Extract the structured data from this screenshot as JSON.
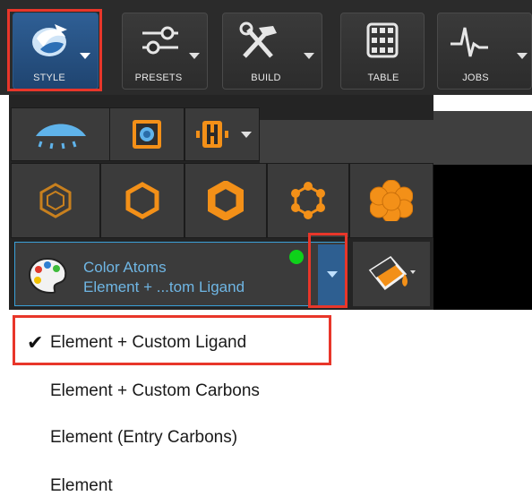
{
  "toolbar": {
    "buttons": [
      {
        "label": "STYLE",
        "icon": "style-palette-icon",
        "selected": true,
        "has_dropdown": true
      },
      {
        "label": "PRESETS",
        "icon": "sliders-icon",
        "selected": false,
        "has_dropdown": true
      },
      {
        "label": "BUILD",
        "icon": "hammer-wrench-icon",
        "selected": false,
        "has_dropdown": true
      },
      {
        "label": "TABLE",
        "icon": "table-grid-icon",
        "selected": false,
        "has_dropdown": false
      },
      {
        "label": "JOBS",
        "icon": "pulse-icon",
        "selected": false,
        "has_dropdown": true
      }
    ]
  },
  "style_panel": {
    "row1_icons": [
      "eye-icon",
      "surface-icon",
      "hbond-icon"
    ],
    "row2_icons": [
      "wire-hexagon-icon",
      "thin-hexagon-icon",
      "thick-hexagon-icon",
      "ball-stick-icon",
      "spacefill-icon"
    ],
    "color_scheme": {
      "title": "Color Atoms",
      "value": "Element + ...tom Ligand",
      "status_color": "#0ed11a"
    }
  },
  "color_menu": {
    "items": [
      {
        "label": "Element + Custom Ligand",
        "checked": true
      },
      {
        "label": "Element + Custom Carbons",
        "checked": false
      },
      {
        "label": "Element (Entry Carbons)",
        "checked": false
      },
      {
        "label": "Element",
        "checked": false
      }
    ]
  },
  "colors": {
    "highlight": "#e8362a",
    "accent": "#6fb6e4",
    "orange": "#f39018"
  }
}
